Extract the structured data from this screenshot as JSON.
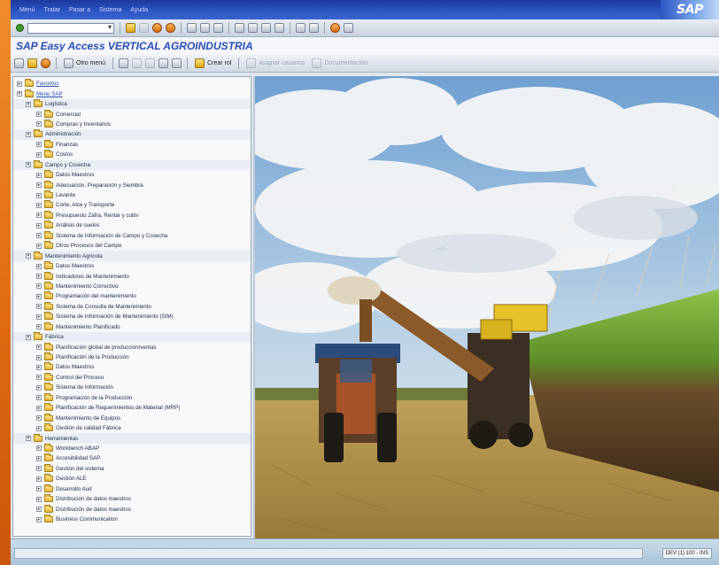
{
  "menu": {
    "items": [
      "Menú",
      "Tratar",
      "Pasar a",
      "Sistema",
      "Ayuda"
    ],
    "logo": "SAP"
  },
  "command_field": {
    "value": ""
  },
  "title": "SAP Easy Access  VERTICAL AGROINDUSTRIA",
  "app_toolbar": {
    "other_menu": "Otro menú",
    "create_role": "Crear rol",
    "assign_users": "Asignar usuarios",
    "documentation": "Documentación"
  },
  "tree": {
    "favorites": "Favoritos",
    "sap_menu": "Menú SAP",
    "sections": [
      {
        "label": "Logística",
        "items": [
          "Comercial",
          "Compras y Inventarios"
        ]
      },
      {
        "label": "Administración",
        "items": [
          "Finanzas",
          "Costos"
        ]
      },
      {
        "label": "Campo y Cosecha",
        "items": [
          "Datos Maestros",
          "Adecuación, Preparación y Siembra",
          "Levante",
          "Corte, Alce y Transporte",
          "Presupuesto Zafra, Rentar y cultiv",
          "Análisis de suelos",
          "Sistema de Información de Campo y Cosecha",
          "Otros Procesos del Campo"
        ]
      },
      {
        "label": "Mantenimiento Agrícola",
        "items": [
          "Datos Maestros",
          "Indicadores de Mantenimiento",
          "Mantenimiento Correctivo",
          "Programación del mantenimiento",
          "Sistema de Consulta de Mantenimiento",
          "Sistema de Información de Mantenimiento (SIM)",
          "Mantenimiento Planificado"
        ]
      },
      {
        "label": "Fábrica",
        "items": [
          "Planificación global de producción/ventas",
          "Planificación de la Producción",
          "Datos Maestros",
          "Control del Proceso",
          "Sistema de Información",
          "Programación de la Producción",
          "Planificación de Requerimientos de Material (MRP)",
          "Mantenimiento de Equipos",
          "Gestión de calidad Fábrica"
        ]
      },
      {
        "label": "Herramientas",
        "items": [
          "Workbench ABAP",
          "Accesibilidad SAP",
          "Gestión del sistema",
          "Gestión ALE",
          "Desarrollo Aud",
          "Distribución de datos maestros",
          "Distribución de datos maestros",
          "Business Communication"
        ]
      }
    ]
  },
  "status": {
    "info": "DEV (1) 100 - INS"
  },
  "colors": {
    "menubar": "#2d55c4",
    "title": "#2a4fb3",
    "background": "#e26b12"
  },
  "icons": [
    "ok-icon",
    "save-icon",
    "back-icon",
    "exit-icon",
    "cancel-icon",
    "print-icon",
    "find-icon",
    "help-icon"
  ]
}
